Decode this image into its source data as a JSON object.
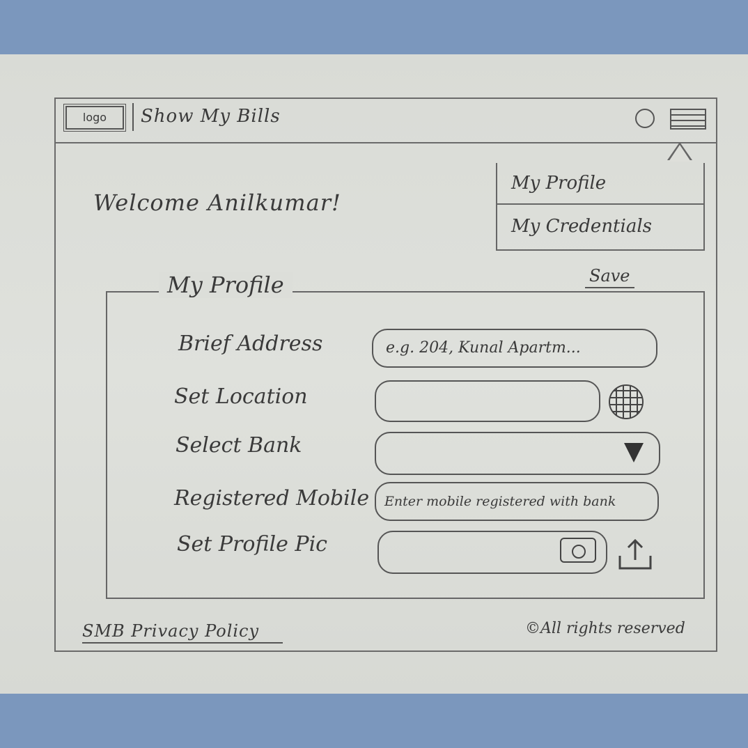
{
  "header": {
    "logo": "logo",
    "app_title": "Show My Bills"
  },
  "menu": {
    "items": [
      {
        "label": "My Profile"
      },
      {
        "label": "My Credentials"
      }
    ]
  },
  "welcome": "Welcome Anilkumar!",
  "profile": {
    "section_title": "My Profile",
    "save_label": "Save",
    "fields": [
      {
        "label": "Brief Address",
        "placeholder": "e.g. 204, Kunal Apartm..."
      },
      {
        "label": "Set Location",
        "placeholder": ""
      },
      {
        "label": "Select Bank",
        "selected": ""
      },
      {
        "label": "Registered Mobile",
        "placeholder": "Enter mobile registered with bank"
      },
      {
        "label": "Set Profile Pic",
        "placeholder": ""
      }
    ]
  },
  "footer": {
    "privacy_link": "SMB Privacy Policy",
    "copyright": "©All rights reserved"
  }
}
